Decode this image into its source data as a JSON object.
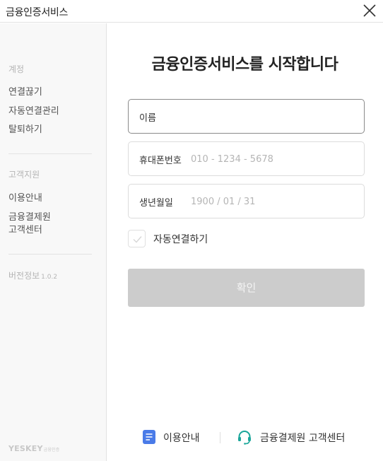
{
  "window": {
    "title": "금융인증서비스"
  },
  "sidebar": {
    "account_header": "계정",
    "account_links": [
      "연결끊기",
      "자동연결관리",
      "탈퇴하기"
    ],
    "support_header": "고객지원",
    "support_links": [
      "이용안내",
      "금융결제원",
      "고객센터"
    ],
    "version_label": "버전정보",
    "version_number": "1.0.2",
    "logo": "YESKEY",
    "logo_sub": "금융인증"
  },
  "main": {
    "heading": "금융인증서비스를 시작합니다",
    "name_field": {
      "label": "이름",
      "value": "",
      "placeholder": ""
    },
    "phone_field": {
      "label": "휴대폰번호",
      "value": "",
      "placeholder": "010 - 1234 - 5678"
    },
    "birth_field": {
      "label": "생년월일",
      "value": "",
      "placeholder": "1900 / 01 / 31"
    },
    "auto_connect": {
      "label": "자동연결하기",
      "checked": false
    },
    "confirm_label": "확인"
  },
  "footer": {
    "guide_label": "이용안내",
    "support_label": "금융결제원 고객센터"
  },
  "colors": {
    "guide_icon": "#4a7be8",
    "support_icon": "#1aa69a",
    "button_disabled": "#cccccc"
  },
  "icons": {
    "close": "close-icon",
    "check": "checkmark-icon",
    "guide": "document-icon",
    "support": "headset-icon"
  }
}
